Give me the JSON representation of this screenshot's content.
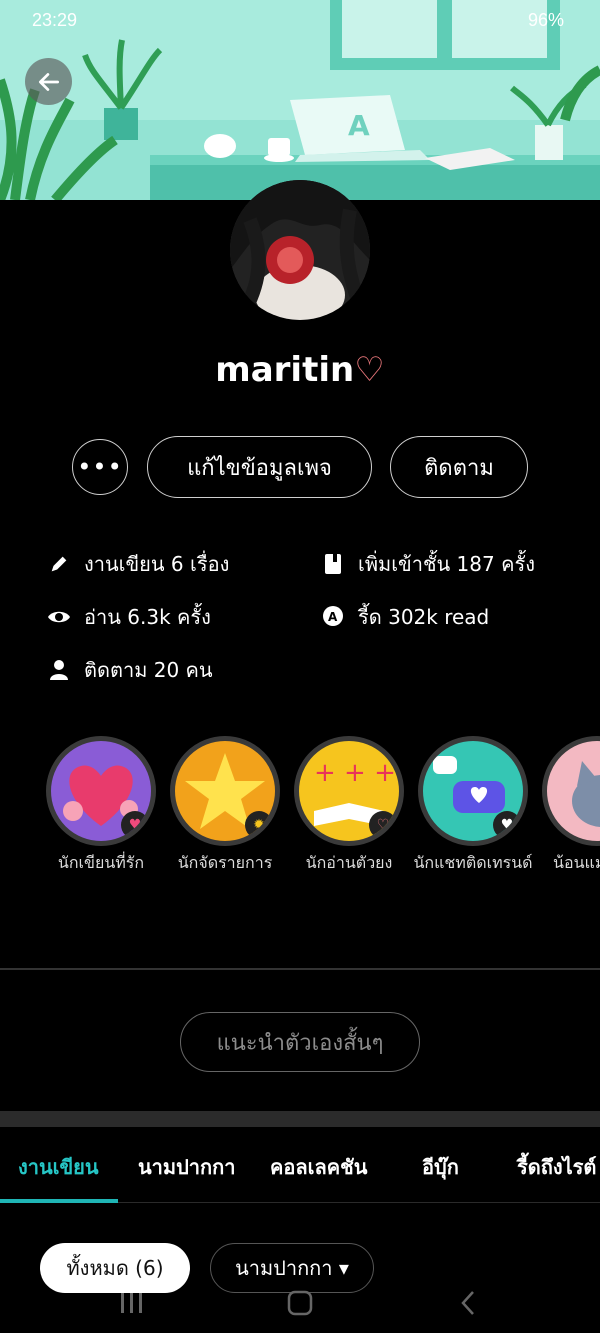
{
  "status_bar": {
    "time": "23:29",
    "battery": "96%"
  },
  "profile": {
    "username": "maritin",
    "username_heart": "♡"
  },
  "actions": {
    "more_label": "•••",
    "edit_label": "แก้ไขข้อมูลเพจ",
    "follow_label": "ติดตาม"
  },
  "stats": {
    "works": "งานเขียน 6 เรื่อง",
    "added": "เพิ่มเข้าชั้น 187 ครั้ง",
    "reads": "อ่าน 6.3k ครั้ง",
    "read_points": "รี้ด 302k read",
    "followers": "ติดตาม 20 คน"
  },
  "badges": [
    {
      "label": "นักเขียนที่รัก",
      "color": "#8a5cd6"
    },
    {
      "label": "นักจัดรายการ",
      "color": "#f2a21b"
    },
    {
      "label": "นักอ่านตัวยง",
      "color": "#f6c51e"
    },
    {
      "label": "นักแชทติดเทรนด์",
      "color": "#35c6b4"
    },
    {
      "label": "น้อนแมวเลิฟ",
      "color": "#f3b9c2"
    }
  ],
  "intro": {
    "label": "แนะนำตัวเองสั้นๆ"
  },
  "tabs": [
    {
      "label": "งานเขียน"
    },
    {
      "label": "นามปากกา"
    },
    {
      "label": "คอลเลคชัน"
    },
    {
      "label": "อีบุ๊ก"
    },
    {
      "label": "รี้ดถึงไรต์"
    }
  ],
  "filters": {
    "all_label": "ทั้งหมด (6)",
    "pen_label": "นามปากกา ▾"
  },
  "colors": {
    "accent": "#1fb5b5",
    "banner": "#7fdcc9"
  }
}
